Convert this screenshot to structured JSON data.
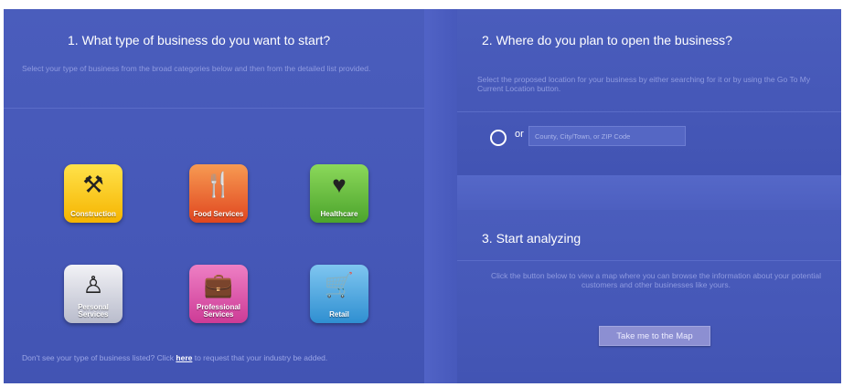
{
  "step1": {
    "title": "1. What type of business do you want to start?",
    "subtitle": "Select your type of business from the broad categories below and then from the detailed list provided.",
    "tiles": [
      {
        "label": "Construction",
        "icon": "tools-icon"
      },
      {
        "label": "Food Services",
        "icon": "fork-knife-icon"
      },
      {
        "label": "Healthcare",
        "icon": "heart-pulse-icon"
      },
      {
        "label": "Personal Services",
        "icon": "person-icon"
      },
      {
        "label": "Professional Services",
        "icon": "briefcase-icon"
      },
      {
        "label": "Retail",
        "icon": "cart-icon"
      }
    ],
    "footnote_prefix": "Don't see your type of business listed? Click ",
    "footnote_link": "here",
    "footnote_suffix": " to request that your industry be added."
  },
  "step2": {
    "title": "2. Where do you plan to open the business?",
    "subtitle": "Select the proposed location for your business by either searching for it or by using the Go To My Current Location button.",
    "or_label": "or",
    "search_placeholder": "County, City/Town, or ZIP Code"
  },
  "step3": {
    "title": "3. Start analyzing",
    "subtitle": "Click the button below to view a map where you can browse the information about your potential customers and other businesses like yours.",
    "button_label": "Take me to the Map"
  }
}
